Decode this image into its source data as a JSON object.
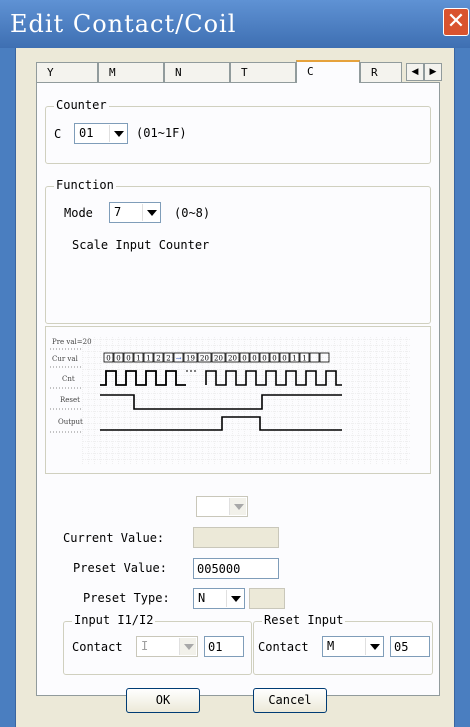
{
  "window": {
    "title": "Edit Contact/Coil",
    "close_symbol": "✕"
  },
  "tabs": [
    {
      "label": "Y"
    },
    {
      "label": "M"
    },
    {
      "label": "N"
    },
    {
      "label": "T"
    },
    {
      "label": "C"
    },
    {
      "label": "R"
    }
  ],
  "tab_scroll": {
    "left": "◀",
    "right": "▶"
  },
  "counter": {
    "legend": "Counter",
    "prefix": "C",
    "selected": "01",
    "range": "(01~1F)"
  },
  "function": {
    "legend": "Function",
    "mode_label": "Mode",
    "mode_selected": "7",
    "mode_range": "(0~8)",
    "description": "Scale Input Counter"
  },
  "timing_diagram": {
    "preset_label": "Pre val=20",
    "cur_val_label": "Cur val",
    "cur_values": [
      "0",
      "0",
      "0",
      "1",
      "1",
      "2",
      "2",
      "→",
      "19",
      "20",
      "20",
      "20",
      "0",
      "0",
      "0",
      "0",
      "0",
      "1",
      "1",
      "",
      ""
    ],
    "rows": [
      "Cnt",
      "Reset",
      "Output"
    ]
  },
  "values": {
    "top_combo": "",
    "current_value_label": "Current Value:",
    "current_value": "",
    "preset_value_label": "Preset Value:",
    "preset_value": "005000",
    "preset_type_label": "Preset Type:",
    "preset_type": "N",
    "preset_type_extra": ""
  },
  "input": {
    "legend": "Input I1/I2",
    "contact_label": "Contact",
    "contact_type": "I",
    "contact_number": "01"
  },
  "reset": {
    "legend": "Reset Input",
    "contact_label": "Contact",
    "contact_type": "M",
    "contact_number": "05"
  },
  "buttons": {
    "ok": "OK",
    "cancel": "Cancel"
  },
  "colors": {
    "titlebar": "#4a7ec0",
    "close": "#d9532f",
    "active_tab": "#e6a23c",
    "dialog": "#ece9d8"
  }
}
